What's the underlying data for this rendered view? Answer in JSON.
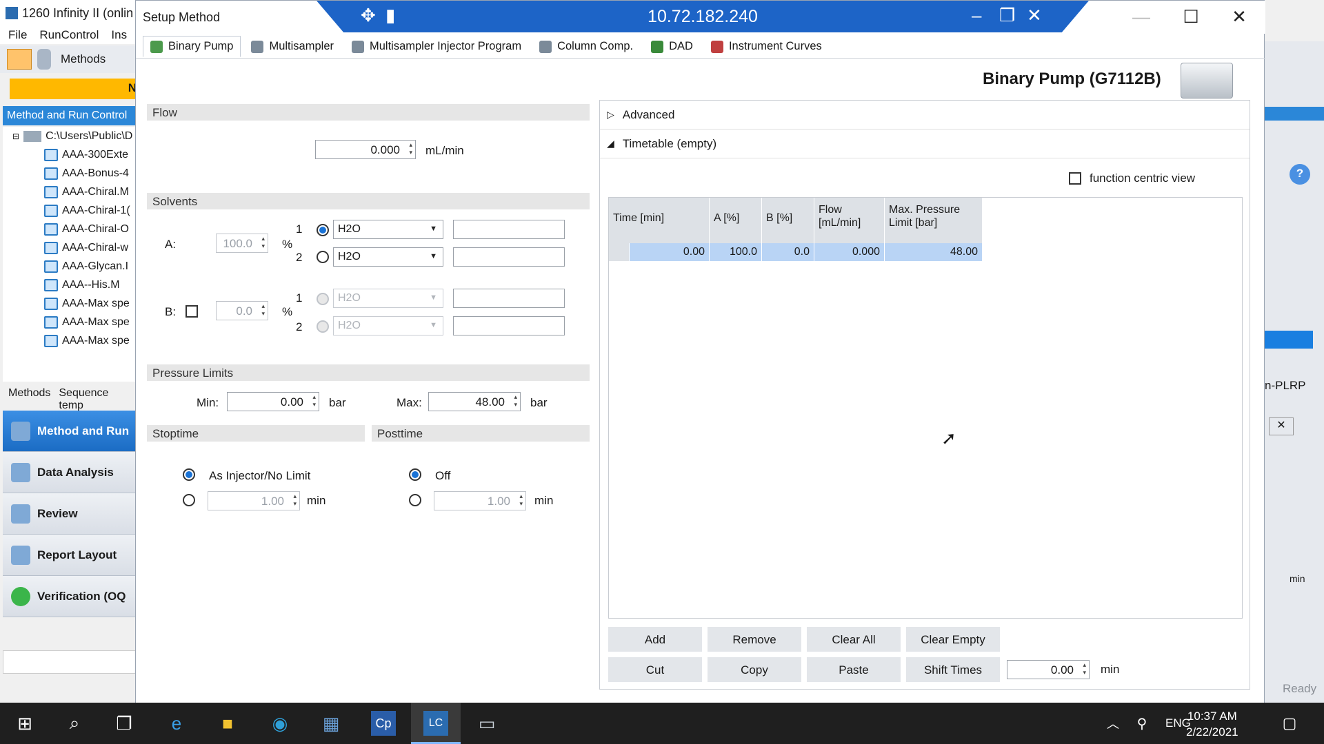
{
  "background_app": {
    "title": "1260 Infinity II (onlin",
    "menu": [
      "File",
      "RunControl",
      "Ins"
    ],
    "toolbar_methods": "Methods",
    "yellow_bar_text": "N",
    "tree_header": "Method and Run Control",
    "tree_root": "C:\\Users\\Public\\D",
    "tree_items": [
      "AAA-300Exte",
      "AAA-Bonus-4",
      "AAA-Chiral.M",
      "AAA-Chiral-1(",
      "AAA-Chiral-O",
      "AAA-Chiral-w",
      "AAA-Glycan.I",
      "AAA--His.M",
      "AAA-Max spe",
      "AAA-Max spe",
      "AAA-Max spe"
    ],
    "bottom_tabs": [
      "Methods",
      "Sequence temp"
    ],
    "nav": [
      "Method and Run",
      "Data Analysis",
      "Review",
      "Report Layout",
      "Verification (OQ"
    ],
    "right_fragments": {
      "text1": "n-PLRP",
      "text2": "min",
      "status": "Ready"
    }
  },
  "dialog": {
    "title": "Setup Method",
    "remote_ip": "10.72.182.240",
    "tabs": [
      "Binary Pump",
      "Multisampler",
      "Multisampler Injector Program",
      "Column Comp.",
      "DAD",
      "Instrument Curves"
    ],
    "device_title": "Binary Pump (G7112B)"
  },
  "flow": {
    "header": "Flow",
    "value": "0.000",
    "unit": "mL/min"
  },
  "solvents": {
    "header": "Solvents",
    "a_label": "A:",
    "a_percent": "100.0",
    "percent_sign": "%",
    "b_label": "B:",
    "b_percent": "0.0",
    "a1_num": "1",
    "a1_solvent": "H2O",
    "a2_num": "2",
    "a2_solvent": "H2O",
    "b1_num": "1",
    "b1_solvent": "H2O",
    "b2_num": "2",
    "b2_solvent": "H2O"
  },
  "pressure": {
    "header": "Pressure Limits",
    "min_label": "Min:",
    "min_value": "0.00",
    "max_label": "Max:",
    "max_value": "48.00",
    "unit": "bar"
  },
  "stoptime": {
    "header": "Stoptime",
    "option1": "As Injector/No Limit",
    "value": "1.00",
    "unit": "min"
  },
  "posttime": {
    "header": "Posttime",
    "option1": "Off",
    "value": "1.00",
    "unit": "min"
  },
  "advanced": {
    "label": "Advanced"
  },
  "timetable": {
    "label": "Timetable (empty)",
    "function_centric": "function centric view",
    "columns": [
      "Time [min]",
      "A [%]",
      "B [%]",
      "Flow\n[mL/min]",
      "Max. Pressure\nLimit [bar]"
    ],
    "row": [
      "0.00",
      "100.0",
      "0.0",
      "0.000",
      "48.00"
    ]
  },
  "buttons": {
    "add": "Add",
    "remove": "Remove",
    "clear_all": "Clear All",
    "clear_empty": "Clear Empty",
    "cut": "Cut",
    "copy": "Copy",
    "paste": "Paste",
    "shift_times": "Shift Times",
    "shift_value": "0.00",
    "shift_unit": "min"
  },
  "taskbar": {
    "lang": "ENG",
    "time": "10:37 AM",
    "date": "2/22/2021"
  }
}
